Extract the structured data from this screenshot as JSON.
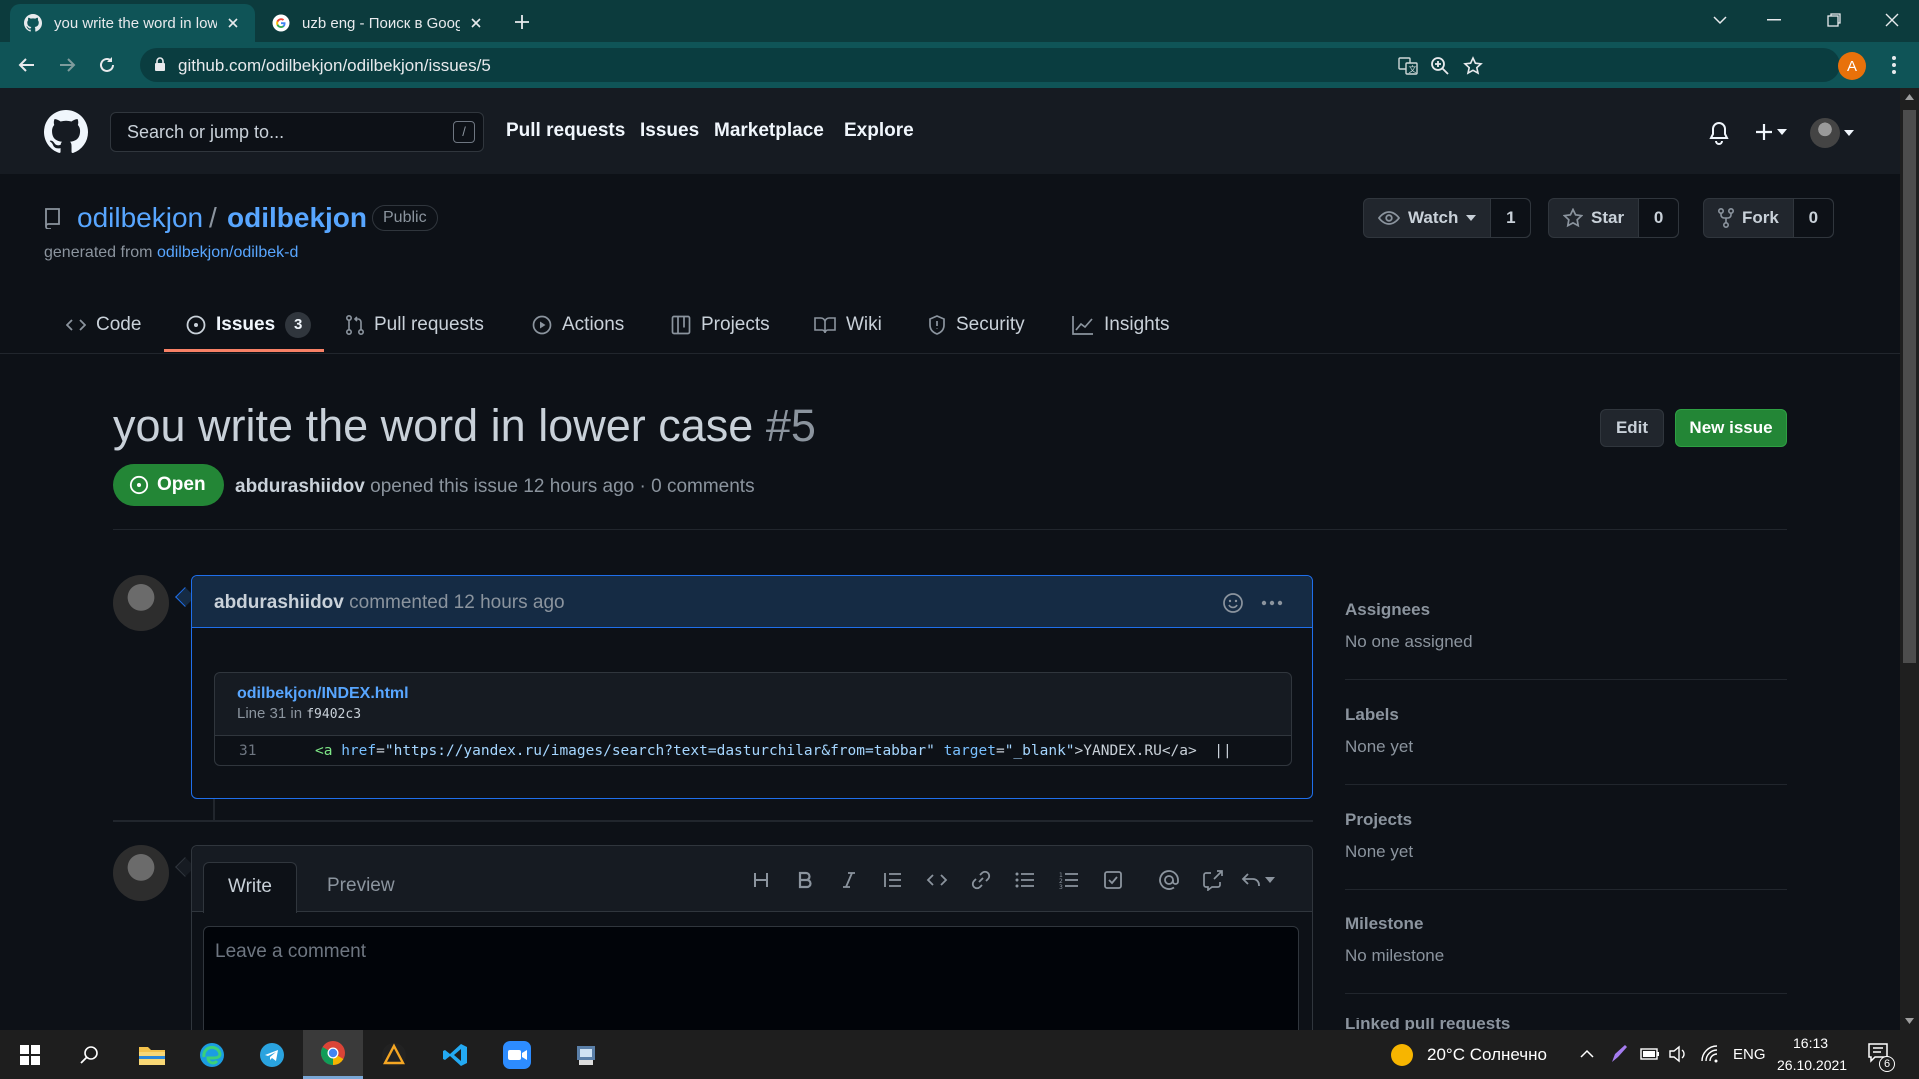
{
  "browser": {
    "tabs": [
      {
        "title": "you write the word in lower case",
        "favicon": "github-icon",
        "active": true
      },
      {
        "title": "uzb eng - Поиск в Google",
        "favicon": "google-icon",
        "active": false
      }
    ],
    "new_tab": "+",
    "url": "github.com/odilbekjon/odilbekjon/issues/5",
    "profile_initial": "A",
    "profile_color": "#e8710a",
    "frame_color": "#0c3b3d"
  },
  "header": {
    "search_placeholder": "Search or jump to...",
    "search_hotkey": "/",
    "nav": [
      "Pull requests",
      "Issues",
      "Marketplace",
      "Explore"
    ]
  },
  "repo": {
    "owner": "odilbekjon",
    "separator": "/",
    "name": "odilbekjon",
    "visibility": "Public",
    "generated_prefix": "generated from ",
    "generated_link": "odilbekjon/odilbek-d",
    "watch": {
      "label": "Watch",
      "count": "1"
    },
    "star": {
      "label": "Star",
      "count": "0"
    },
    "fork": {
      "label": "Fork",
      "count": "0"
    },
    "tabs": [
      {
        "label": "Code",
        "icon": "code-icon"
      },
      {
        "label": "Issues",
        "icon": "issue-opened-icon",
        "count": "3",
        "selected": true
      },
      {
        "label": "Pull requests",
        "icon": "git-pull-request-icon"
      },
      {
        "label": "Actions",
        "icon": "play-icon"
      },
      {
        "label": "Projects",
        "icon": "table-icon"
      },
      {
        "label": "Wiki",
        "icon": "book-icon"
      },
      {
        "label": "Security",
        "icon": "shield-icon"
      },
      {
        "label": "Insights",
        "icon": "graph-icon"
      }
    ]
  },
  "issue": {
    "title": "you write the word in lower case",
    "number": "#5",
    "edit_label": "Edit",
    "new_issue_label": "New issue",
    "state": "Open",
    "author": "abdurashiidov",
    "meta_rest": " opened this issue 12 hours ago · 0 comments",
    "accent_open": "#238636"
  },
  "comment": {
    "author": "abdurashiidov",
    "action": " commented 12 hours ago",
    "snippet": {
      "file": "odilbekjon/INDEX.html",
      "line_prefix": "Line 31 in ",
      "commit": "f9402c3",
      "line_number": "31",
      "code": {
        "t1": "<a",
        "a1": " href",
        "e1": "=",
        "s1": "\"https://yandex.ru/images/search?text=dasturchilar&from=tabbar\"",
        "a2": " target",
        "e2": "=",
        "s2": "\"_blank\"",
        "t2": ">YANDEX.RU</a>",
        "tail": "  ||"
      }
    }
  },
  "new_comment": {
    "tab_write": "Write",
    "tab_preview": "Preview",
    "placeholder": "Leave a comment"
  },
  "sidebar": {
    "assignees": {
      "title": "Assignees",
      "value": "No one assigned"
    },
    "labels": {
      "title": "Labels",
      "value": "None yet"
    },
    "projects": {
      "title": "Projects",
      "value": "None yet"
    },
    "milestone": {
      "title": "Milestone",
      "value": "No milestone"
    },
    "linked": {
      "title": "Linked pull requests"
    }
  },
  "taskbar": {
    "weather": "20°C  Солнечно",
    "lang": "ENG",
    "time": "16:13",
    "date": "26.10.2021",
    "notifications": "6"
  }
}
